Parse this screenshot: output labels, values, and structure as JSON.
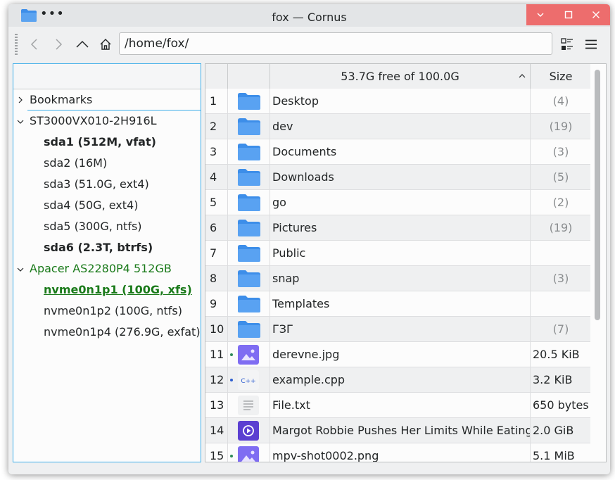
{
  "window": {
    "title": "fox — Cornus",
    "menu_dots": "•••"
  },
  "toolbar": {
    "address": "/home/fox/"
  },
  "sidebar": {
    "bookmarks": "Bookmarks",
    "disk1": "ST3000VX010-2H916L",
    "disk1_parts": [
      "sda1 (512M, vfat)",
      "sda2 (16M)",
      "sda3 (51.0G, ext4)",
      "sda4 (50G, ext4)",
      "sda5 (300G, ntfs)",
      "sda6 (2.3T, btrfs)"
    ],
    "disk2": "Apacer AS2280P4 512GB",
    "disk2_parts": [
      "nvme0n1p1 (100G, xfs)",
      "nvme0n1p2 (100G, ntfs)",
      "nvme0n1p4 (276.9G, exfat)"
    ]
  },
  "table": {
    "free_label": "53.7G free of 100.0G",
    "size_header": "Size",
    "rows": [
      {
        "n": "1",
        "name": "Desktop",
        "size": "(4)",
        "type": "folder"
      },
      {
        "n": "2",
        "name": "dev",
        "size": "(19)",
        "type": "folder"
      },
      {
        "n": "3",
        "name": "Documents",
        "size": "(3)",
        "type": "folder"
      },
      {
        "n": "4",
        "name": "Downloads",
        "size": "(5)",
        "type": "folder"
      },
      {
        "n": "5",
        "name": "go",
        "size": "(2)",
        "type": "folder"
      },
      {
        "n": "6",
        "name": "Pictures",
        "size": "(19)",
        "type": "folder"
      },
      {
        "n": "7",
        "name": "Public",
        "size": "",
        "type": "folder"
      },
      {
        "n": "8",
        "name": "snap",
        "size": "(3)",
        "type": "folder"
      },
      {
        "n": "9",
        "name": "Templates",
        "size": "",
        "type": "folder"
      },
      {
        "n": "10",
        "name": "ГЗГ",
        "size": "(7)",
        "type": "folder"
      },
      {
        "n": "11",
        "name": "derevne.jpg",
        "size": "20.5 KiB",
        "type": "image"
      },
      {
        "n": "12",
        "name": "example.cpp",
        "size": "3.2 KiB",
        "type": "cpp"
      },
      {
        "n": "13",
        "name": "File.txt",
        "size": "650 bytes",
        "type": "text"
      },
      {
        "n": "14",
        "name": "Margot Robbie Pushes Her Limits While Eating",
        "size": "2.0 GiB",
        "type": "video"
      },
      {
        "n": "15",
        "name": "mpv-shot0002.png",
        "size": "5.1 MiB",
        "type": "image"
      }
    ]
  },
  "icons": {
    "cpp_label": "C++"
  },
  "colors": {
    "accent": "#3daee9",
    "folder": "#3d8ee9",
    "close_group": "#ed6d6d",
    "green_text": "#1a7a1a",
    "image_icon": "#7f6df2",
    "video_icon": "#5b3fd1"
  }
}
